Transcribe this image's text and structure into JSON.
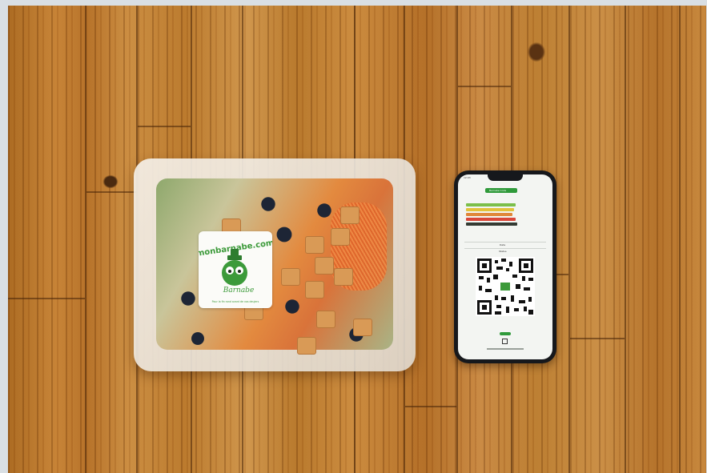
{
  "image": {
    "scene": "natural-photo",
    "background_color": "#d9dfe4"
  },
  "sticker": {
    "brand_text": "monbarnabe.com",
    "mascot_name": "Barnabe",
    "tagline": "Pour la fin rond avant de vos deujers",
    "accent_color": "#3c9a3a"
  },
  "phone_screen": {
    "time": "12:03",
    "header_button": "Barnabe Code",
    "date_label": "Date",
    "status_label": "Status",
    "brand_color": "#2f9a3a"
  }
}
